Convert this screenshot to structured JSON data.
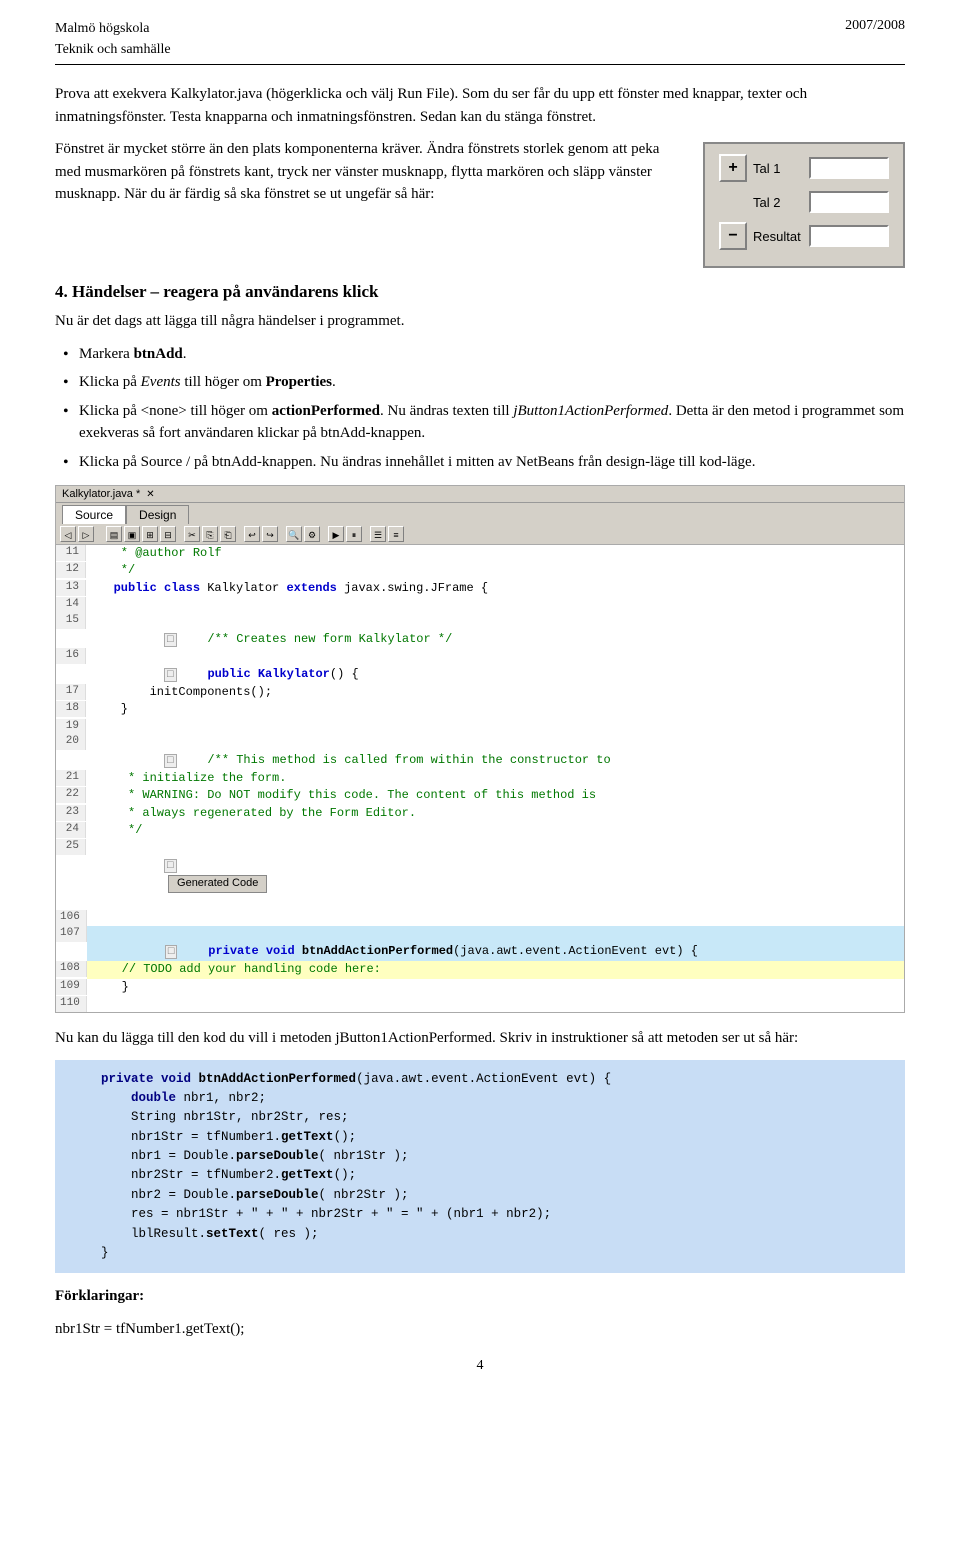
{
  "header": {
    "left_line1": "Malmö högskola",
    "left_line2": "Teknik och samhälle",
    "right": "2007/2008"
  },
  "paragraphs": {
    "p1": "Prova att exekvera Kalkylator.java (högerklicka och välj Run File). Som du ser får du upp ett fönster med knappar, texter och inmatningsfönster. Testa knapparna och inmatningsfönstren. Sedan kan du stänga fönstret.",
    "p2": "Fönstret är mycket större än den plats komponenterna kräver. Ändra fönstrets storlek genom att peka med musmarkören på fönstrets kant, tryck ner vänster musknapp, flytta markören och släpp vänster musknapp. När du är färdig så ska fönstret se ut ungefär så här:"
  },
  "section4": {
    "heading": "4. Händelser – reagera på användarens klick",
    "p1": "Nu är det dags att lägga till några händelser i programmet.",
    "bullets": [
      "Markera btnAdd.",
      "Klicka på Events till höger om Properties.",
      "Klicka på <none> till höger om actionPerformed. Nu ändras texten till jButton1ActionPerformed. Detta är den metod i programmet som exekveras så fort användaren klickar på btnAdd-knappen.",
      "Klicka på Source / på btnAdd-knappen. Nu ändras innehållet i mitten av NetBeans från design-läge till kod-läge."
    ]
  },
  "calculator": {
    "plus_label": "+",
    "minus_label": "−",
    "tal1_label": "Tal 1",
    "tal2_label": "Tal 2",
    "resultat_label": "Resultat"
  },
  "editor": {
    "filename": "Kalkylator.java *",
    "tab_source": "Source",
    "tab_design": "Design",
    "lines": [
      {
        "num": "11",
        "code": "    * @author Rolf",
        "type": "normal"
      },
      {
        "num": "12",
        "code": "    */",
        "type": "normal"
      },
      {
        "num": "13",
        "code": "   public class Kalkylator extends javax.swing.JFrame {",
        "type": "normal",
        "bold_kw": true
      },
      {
        "num": "14",
        "code": "",
        "type": "normal"
      },
      {
        "num": "15",
        "code": "    /** Creates new form Kalkylator */",
        "type": "normal",
        "cm": true
      },
      {
        "num": "16",
        "code": "    public Kalkylator() {",
        "type": "normal",
        "bold_kw": true
      },
      {
        "num": "17",
        "code": "        initComponents();",
        "type": "normal"
      },
      {
        "num": "18",
        "code": "    }",
        "type": "normal"
      },
      {
        "num": "19",
        "code": "",
        "type": "normal"
      },
      {
        "num": "20",
        "code": "    /** This method is called from within the constructor to",
        "type": "normal",
        "cm": true
      },
      {
        "num": "21",
        "code": "     * initialize the form.",
        "type": "normal",
        "cm": true
      },
      {
        "num": "22",
        "code": "     * WARNING: Do NOT modify this code. The content of this method is",
        "type": "normal",
        "cm": true
      },
      {
        "num": "23",
        "code": "     * always regenerated by the Form Editor.",
        "type": "normal",
        "cm": true
      },
      {
        "num": "24",
        "code": "     */",
        "type": "normal",
        "cm": true
      },
      {
        "num": "25",
        "code": "    [GENERATED_CODE]",
        "type": "generated"
      },
      {
        "num": "106",
        "code": "",
        "type": "normal"
      },
      {
        "num": "107",
        "code": "    private void btnAddActionPerformed(java.awt.event.ActionEvent evt) {",
        "type": "highlight"
      },
      {
        "num": "108",
        "code": "    // TODO add your handling code here:",
        "type": "comment_line"
      },
      {
        "num": "109",
        "code": "    }",
        "type": "normal"
      },
      {
        "num": "110",
        "code": "",
        "type": "normal"
      }
    ],
    "generated_label": "Generated Code"
  },
  "code_block": {
    "lines": [
      "    private void btnAddActionPerformed(java.awt.event.ActionEvent evt) {",
      "        double nbr1, nbr2;",
      "        String nbr1Str, nbr2Str, res;",
      "        nbr1Str = tfNumber1.getText();",
      "        nbr1 = Double.parseDouble( nbr1Str );",
      "        nbr2Str = tfNumber2.getText();",
      "        nbr2 = Double.parseDouble( nbr2Str );",
      "        res = nbr1Str + \" + \" + nbr2Str + \" = \" + (nbr1 + nbr2);",
      "        lblResult.setText( res );",
      "    }"
    ]
  },
  "footer": {
    "paragraph_intro": "Nu kan du lägga till den kod du vill i metoden jButton1ActionPerformed. Skriv in instruktioner så att metoden ser ut så här:",
    "explanations_heading": "Förklaringar:",
    "explanation1": "nbr1Str = tfNumber1.getText();"
  },
  "page_number": "4"
}
